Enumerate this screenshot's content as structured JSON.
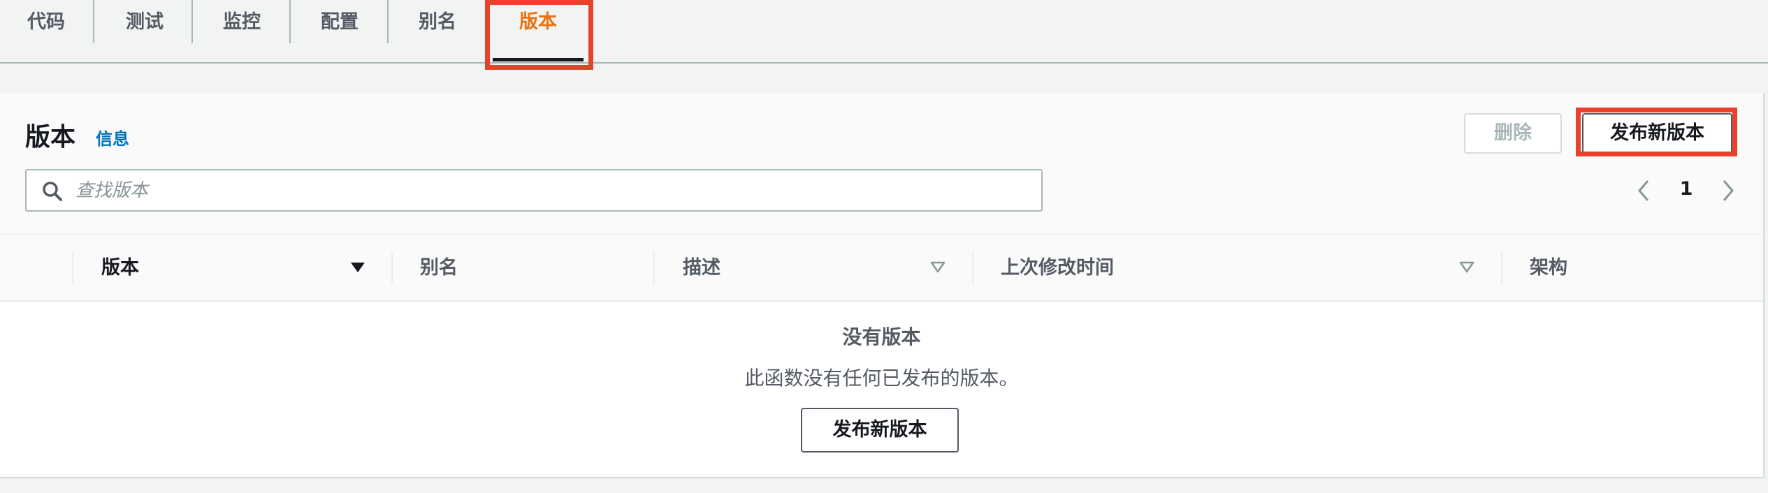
{
  "tabs": [
    {
      "label": "代码"
    },
    {
      "label": "测试"
    },
    {
      "label": "监控"
    },
    {
      "label": "配置"
    },
    {
      "label": "别名"
    },
    {
      "label": "版本",
      "active": true
    }
  ],
  "panel": {
    "title": "版本",
    "info_link": "信息",
    "delete_button": "删除",
    "publish_button": "发布新版本"
  },
  "search": {
    "placeholder": "查找版本"
  },
  "pagination": {
    "current_page": "1"
  },
  "table": {
    "columns": [
      {
        "label": "版本",
        "sortable": true,
        "sorted": "desc"
      },
      {
        "label": "别名",
        "sortable": false
      },
      {
        "label": "描述",
        "sortable": true
      },
      {
        "label": "上次修改时间",
        "sortable": true
      },
      {
        "label": "架构",
        "sortable": false
      }
    ]
  },
  "empty_state": {
    "title": "没有版本",
    "description": "此函数没有任何已发布的版本。",
    "button": "发布新版本"
  },
  "colors": {
    "accent": "#ec7211",
    "link": "#0073bb",
    "highlight": "#e8422c"
  }
}
